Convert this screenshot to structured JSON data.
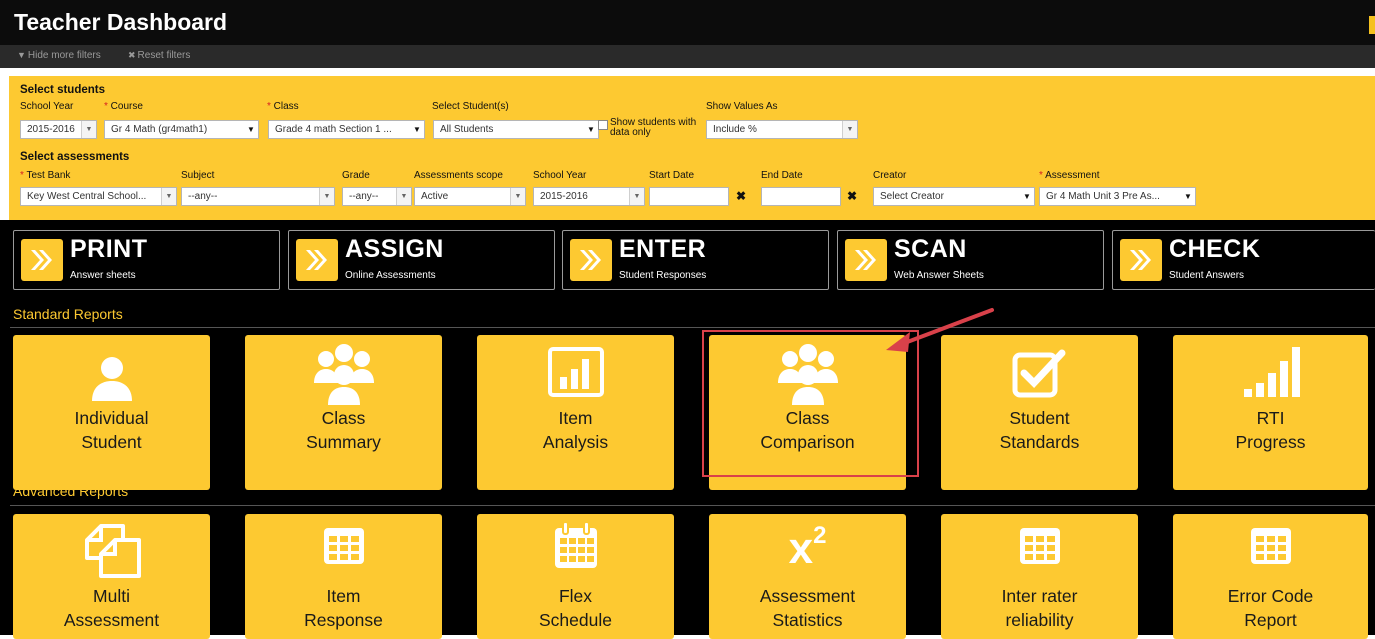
{
  "app": {
    "title": "Teacher Dashboard"
  },
  "filter_bar": {
    "hide_filters": "Hide more filters",
    "reset_filters": "Reset filters"
  },
  "select_students": {
    "heading": "Select students",
    "school_year": {
      "label": "School Year",
      "value": "2015-2016"
    },
    "course": {
      "label": "Course",
      "value": "Gr 4 Math (gr4math1)"
    },
    "class": {
      "label": "Class",
      "value": "Grade 4 math Section 1 ..."
    },
    "students": {
      "label": "Select Student(s)",
      "value": "All Students"
    },
    "show_data_only": {
      "label": "Show students with",
      "label2": "data only"
    },
    "show_values": {
      "label": "Show Values As",
      "value": "Include %"
    }
  },
  "select_assessments": {
    "heading": "Select assessments",
    "test_bank": {
      "label": "Test Bank",
      "value": "Key West Central School..."
    },
    "subject": {
      "label": "Subject",
      "value": "--any--"
    },
    "grade": {
      "label": "Grade",
      "value": "--any--"
    },
    "scope": {
      "label": "Assessments scope",
      "value": "Active"
    },
    "school_year": {
      "label": "School Year",
      "value": "2015-2016"
    },
    "start_date": {
      "label": "Start Date",
      "value": ""
    },
    "end_date": {
      "label": "End Date",
      "value": ""
    },
    "creator": {
      "label": "Creator",
      "value": "Select Creator"
    },
    "assessment": {
      "label": "Assessment",
      "value": "Gr 4 Math Unit 3 Pre As..."
    }
  },
  "actions": [
    {
      "title": "PRINT",
      "subtitle": "Answer sheets"
    },
    {
      "title": "ASSIGN",
      "subtitle": "Online Assessments"
    },
    {
      "title": "ENTER",
      "subtitle": "Student Responses"
    },
    {
      "title": "SCAN",
      "subtitle": "Web Answer Sheets"
    },
    {
      "title": "CHECK",
      "subtitle": "Student Answers"
    }
  ],
  "standard_reports": {
    "heading": "Standard Reports",
    "tiles": [
      {
        "line1": "Individual",
        "line2": "Student",
        "icon": "person-icon"
      },
      {
        "line1": "Class",
        "line2": "Summary",
        "icon": "group-icon"
      },
      {
        "line1": "Item",
        "line2": "Analysis",
        "icon": "bar-chart-icon"
      },
      {
        "line1": "Class",
        "line2": "Comparison",
        "icon": "group-icon"
      },
      {
        "line1": "Student",
        "line2": "Standards",
        "icon": "checkbox-icon"
      },
      {
        "line1": "RTI",
        "line2": "Progress",
        "icon": "signal-bars-icon"
      }
    ]
  },
  "advanced_reports": {
    "heading": "Advanced Reports",
    "tiles": [
      {
        "line1": "Multi",
        "line2": "Assessment",
        "icon": "copy-documents-icon"
      },
      {
        "line1": "Item",
        "line2": "Response",
        "icon": "table-icon"
      },
      {
        "line1": "Flex",
        "line2": "Schedule",
        "icon": "calendar-icon"
      },
      {
        "line1": "Assessment",
        "line2": "Statistics",
        "icon": "x-squared-icon"
      },
      {
        "line1": "Inter rater",
        "line2": "reliability",
        "icon": "table-icon"
      },
      {
        "line1": "Error Code",
        "line2": "Report",
        "icon": "table-icon"
      }
    ]
  },
  "x_squared_glyph": {
    "base": "x",
    "exp": "2"
  },
  "colors": {
    "accent": "#fdc931",
    "background": "#000000",
    "highlight": "#d9414a"
  }
}
